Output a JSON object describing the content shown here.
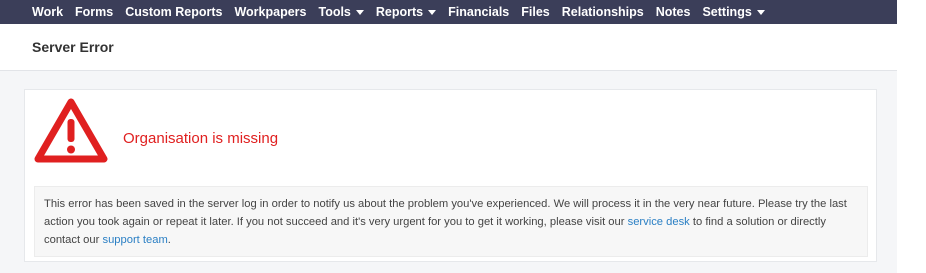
{
  "nav": {
    "items": [
      {
        "label": "Work",
        "dropdown": false
      },
      {
        "label": "Forms",
        "dropdown": false
      },
      {
        "label": "Custom Reports",
        "dropdown": false
      },
      {
        "label": "Workpapers",
        "dropdown": false
      },
      {
        "label": "Tools",
        "dropdown": true
      },
      {
        "label": "Reports",
        "dropdown": true
      },
      {
        "label": "Financials",
        "dropdown": false
      },
      {
        "label": "Files",
        "dropdown": false
      },
      {
        "label": "Relationships",
        "dropdown": false
      },
      {
        "label": "Notes",
        "dropdown": false
      },
      {
        "label": "Settings",
        "dropdown": true
      }
    ]
  },
  "header": {
    "title": "Server Error"
  },
  "error": {
    "icon": "warning-triangle-icon",
    "title": "Organisation is missing",
    "message_part1": "This error has been saved in the server log in order to notify us about the problem you've experienced. We will process it in the very near future. Please try the last action you took again or repeat it later. If you not succeed and it's very urgent for you to get it working, please visit our ",
    "service_desk_link": "service desk",
    "message_part2": " to find a solution or directly contact our ",
    "support_team_link": "support team",
    "message_part3": "."
  },
  "colors": {
    "navbar": "#3b3e59",
    "error_red": "#e02020",
    "link_blue": "#2a7fc4"
  }
}
